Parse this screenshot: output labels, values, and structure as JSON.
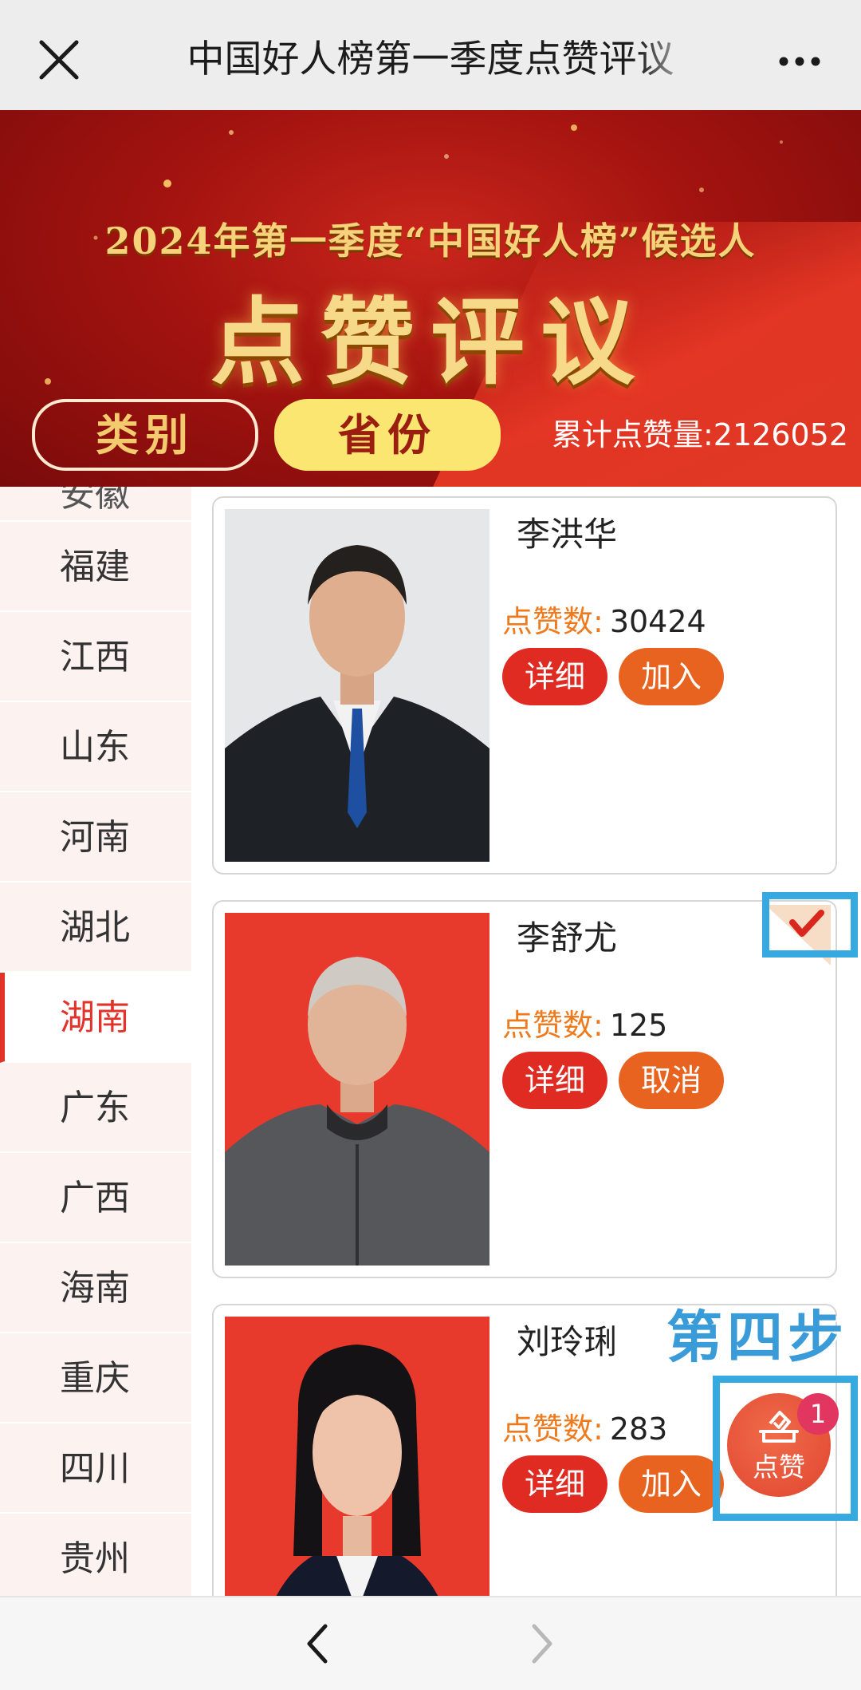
{
  "topbar": {
    "title": "中国好人榜第一季度点赞评议"
  },
  "banner": {
    "subtitle": "2024年第一季度“中国好人榜”候选人",
    "headline": "点赞评议",
    "tabs": [
      {
        "label": "类别"
      },
      {
        "label": "省份"
      }
    ],
    "total_likes": "累计点赞量:2126052"
  },
  "sidebar": {
    "partial_item": "安徽",
    "items": [
      {
        "label": "福建"
      },
      {
        "label": "江西"
      },
      {
        "label": "山东"
      },
      {
        "label": "河南"
      },
      {
        "label": "湖北"
      },
      {
        "label": "湖南"
      },
      {
        "label": "广东"
      },
      {
        "label": "广西"
      },
      {
        "label": "海南"
      },
      {
        "label": "重庆"
      },
      {
        "label": "四川"
      },
      {
        "label": "贵州"
      }
    ],
    "active_label": "湖南"
  },
  "candidates": [
    {
      "name": "李洪华",
      "likes_label": "点赞数:",
      "likes": "30424",
      "detail_label": "详细",
      "action_label": "加入",
      "selected": false
    },
    {
      "name": "李舒尤",
      "likes_label": "点赞数:",
      "likes": "125",
      "detail_label": "详细",
      "action_label": "取消",
      "selected": true
    },
    {
      "name": "刘玲琍",
      "likes_label": "点赞数:",
      "likes": "283",
      "detail_label": "详细",
      "action_label": "加入",
      "selected": false
    }
  ],
  "annotation": {
    "step_label": "第四步"
  },
  "vote_button": {
    "label": "点赞",
    "badge_count": "1"
  },
  "colors": {
    "accent_red": "#df2b22",
    "accent_orange": "#e8631f",
    "highlight_blue": "#35a9e0",
    "active_text": "#e2322a",
    "sidebar_bg": "#fcf2f0"
  },
  "icons": [
    "close-icon",
    "more-icon",
    "checkmark-icon",
    "vote-icon",
    "back-arrow-icon",
    "forward-arrow-icon"
  ]
}
